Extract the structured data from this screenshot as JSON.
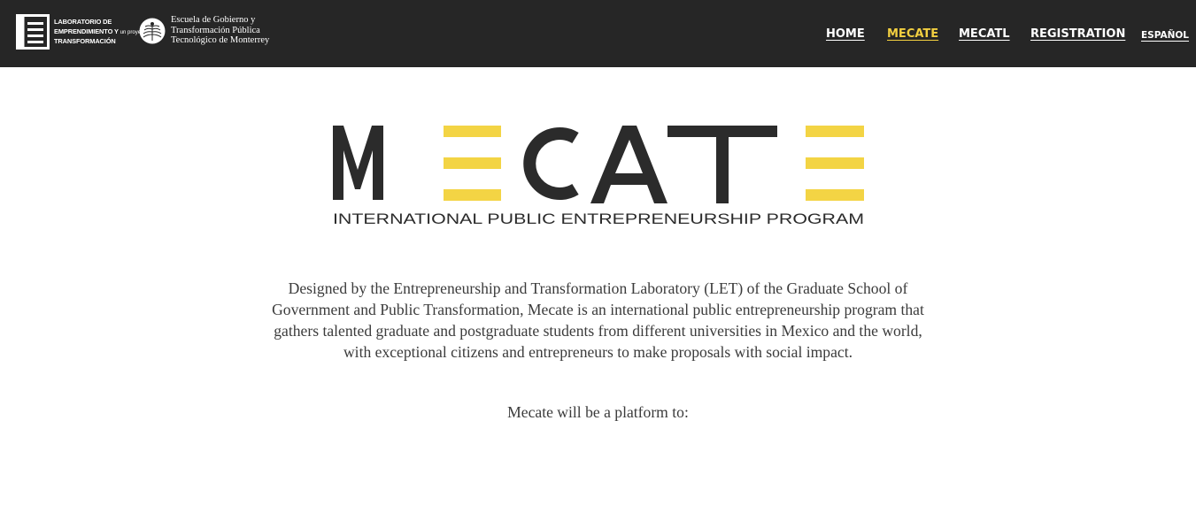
{
  "header": {
    "let_logo": {
      "icon": "document-lines-icon",
      "line1": "LABORATORIO DE",
      "line2": "EMPRENDIMIENTO Y",
      "line2_small": "un proyecto de",
      "line3": "TRANSFORMACIÓN"
    },
    "tec_logo": {
      "icon": "tec-seal-icon",
      "line1": "Escuela de Gobierno y",
      "line2": "Transformación Pública",
      "line3": "Tecnológico de Monterrey"
    },
    "nav": {
      "home": "HOME",
      "mecate": "MECATE",
      "mecatl": "MECATL",
      "registration": "REGISTRATION",
      "language": "ESPAÑOL"
    },
    "colors": {
      "background": "#262626",
      "active": "#f2cf40",
      "link": "#ffffff"
    }
  },
  "hero": {
    "logo_letters": [
      "M",
      "E",
      "C",
      "A",
      "T",
      "E"
    ],
    "logo_tagline": "INTERNATIONAL PUBLIC ENTREPRENEURSHIP PROGRAM",
    "logo_colors": {
      "dark": "#2b2b2b",
      "accent": "#f3d444"
    }
  },
  "content": {
    "description": "Designed by the Entrepreneurship and Transformation Laboratory (LET) of the Graduate School of Government and Public Transformation, Mecate is an international public entrepreneurship program that gathers talented graduate and postgraduate students from different universities in Mexico and the world, with exceptional citizens and entrepreneurs to make proposals with social impact.",
    "platform_intro": "Mecate will be a platform to:"
  }
}
